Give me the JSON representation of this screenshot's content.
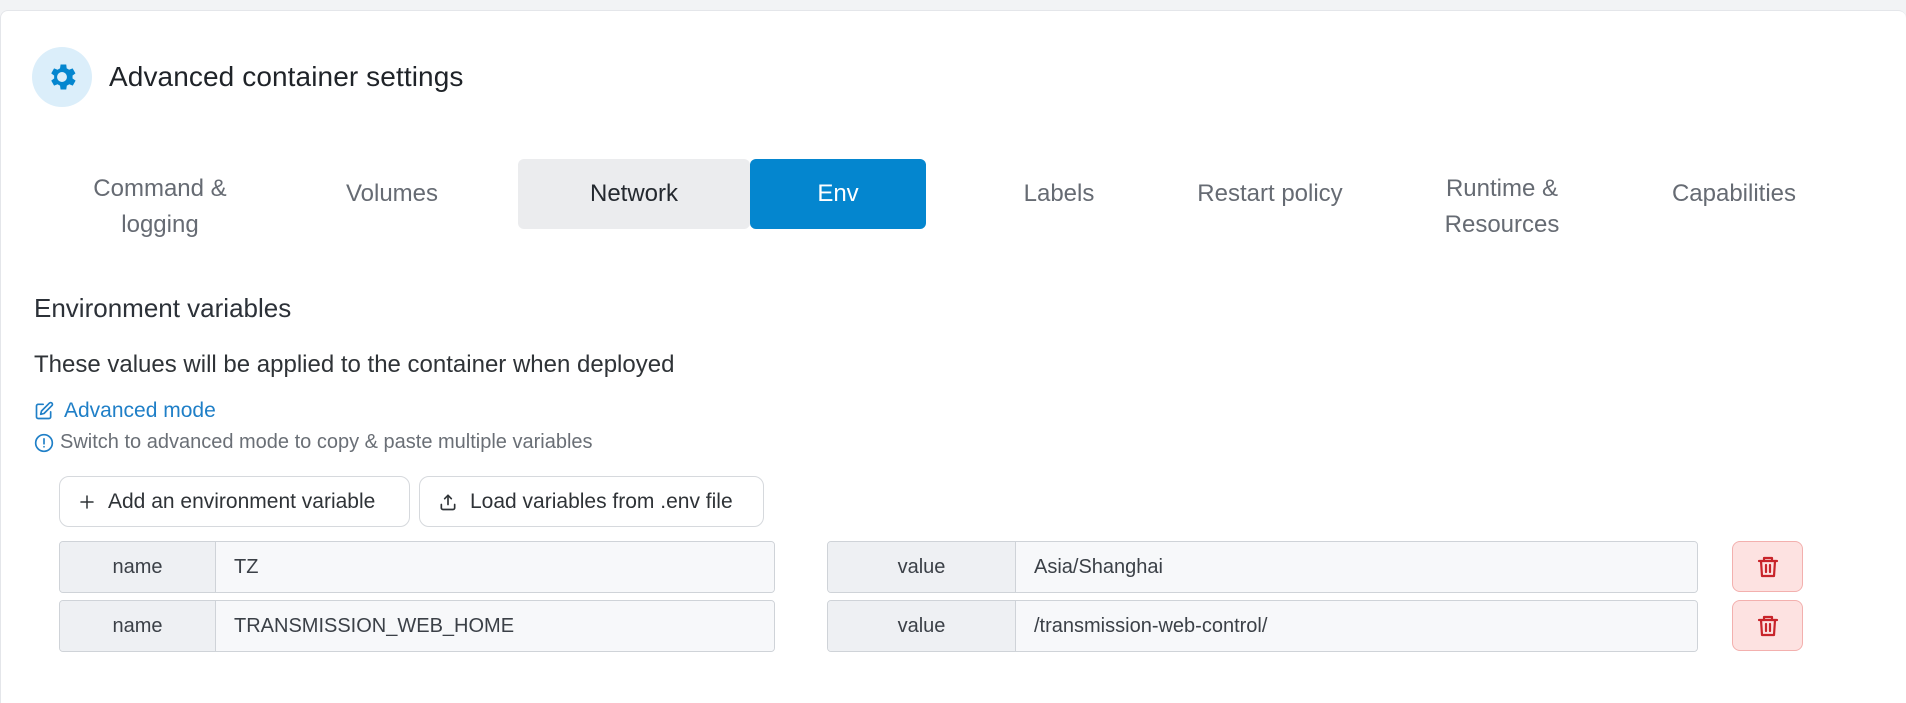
{
  "header": {
    "title": "Advanced container settings",
    "icon": "gear-icon",
    "accent": "#0486cf"
  },
  "tabs": [
    {
      "label": "Command &\nlogging",
      "state": "normal"
    },
    {
      "label": "Volumes",
      "state": "normal"
    },
    {
      "label": "Network",
      "state": "hover"
    },
    {
      "label": "Env",
      "state": "active"
    },
    {
      "label": "Labels",
      "state": "normal"
    },
    {
      "label": "Restart policy",
      "state": "normal"
    },
    {
      "label": "Runtime &\nResources",
      "state": "normal"
    },
    {
      "label": "Capabilities",
      "state": "normal"
    }
  ],
  "env": {
    "title": "Environment variables",
    "description": "These values will be applied to the container when deployed",
    "advanced_link": "Advanced mode",
    "advanced_hint": "Switch to advanced mode to copy & paste multiple variables",
    "add_button": "Add an environment variable",
    "load_button": "Load variables from .env file",
    "rows": [
      {
        "name_label": "name",
        "name": "TZ",
        "value_label": "value",
        "value": "Asia/Shanghai"
      },
      {
        "name_label": "name",
        "name": "TRANSMISSION_WEB_HOME",
        "value_label": "value",
        "value": "/transmission-web-control/"
      }
    ]
  },
  "colors": {
    "active_tab": "#0486cf",
    "link": "#1f7fc7",
    "danger": "#c8242a",
    "danger_bg": "#fde2e1"
  }
}
